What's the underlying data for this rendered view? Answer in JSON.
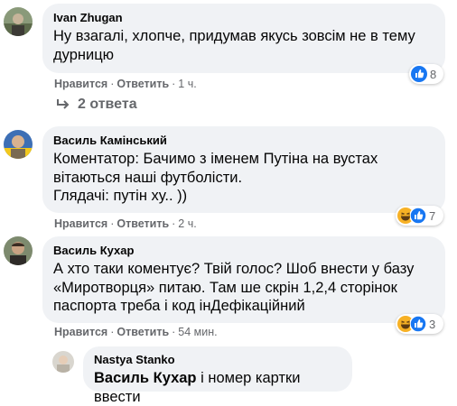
{
  "comments": [
    {
      "author": "Ivan Zhugan",
      "text": "Ну взагалі, хлопче, придумав якусь зовсім не в тему дурницю",
      "like_label": "Нравится",
      "reply_label": "Ответить",
      "time": "1 ч.",
      "reaction_count": "8",
      "reactions": [
        "like-icon"
      ]
    },
    {
      "author": "Василь Камінський",
      "text": "Коментатор: Бачимо з іменем Путіна на вустах\nвітаються наші футболісти.\nГлядачі: путін ху.. ))",
      "like_label": "Нравится",
      "reply_label": "Ответить",
      "time": "2 ч.",
      "reaction_count": "7",
      "reactions": [
        "laugh-icon",
        "like-icon"
      ]
    },
    {
      "author": "Василь Кухар",
      "text": "А хто таки коментує? Твій голос? Шоб внести у базу\n«Миротворця» питаю. Там ше скрін 1,2,4 сторінок\nпаспорта треба і код інДефікаційний",
      "like_label": "Нравится",
      "reply_label": "Ответить",
      "time": "54 мин.",
      "reaction_count": "3",
      "reactions": [
        "laugh-icon",
        "like-icon"
      ]
    }
  ],
  "replies_toggle": {
    "label": "2 ответа",
    "icon": "reply-arrow-icon"
  },
  "reply": {
    "author": "Nastya Stanko",
    "mention": "Василь Кухар",
    "text": " і номер картки ввести"
  },
  "colors": {
    "bubble": "#f0f2f5",
    "secondary_text": "#65676b",
    "like_blue": "#1877f2",
    "laugh_yellow": "#f7b125"
  }
}
